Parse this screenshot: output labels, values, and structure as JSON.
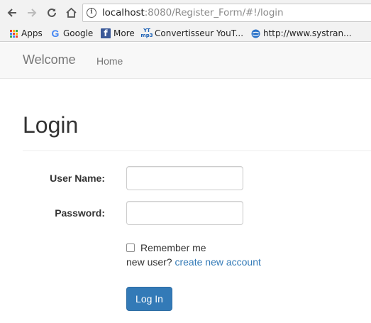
{
  "browser": {
    "url_host": "localhost",
    "url_rest": ":8080/Register_Form/#!/login",
    "bookmarks": [
      {
        "label": "Apps",
        "icon": "apps-grid-icon"
      },
      {
        "label": "Google",
        "icon": "google-icon"
      },
      {
        "label": "More",
        "icon": "facebook-icon"
      },
      {
        "label": "Convertisseur YouT...",
        "icon": "youtube-mp3-icon"
      },
      {
        "label": "http://www.systran...",
        "icon": "systran-globe-icon"
      }
    ]
  },
  "navbar": {
    "brand": "Welcome",
    "home_link": "Home"
  },
  "form": {
    "title": "Login",
    "username_label": "User Name:",
    "username_value": "",
    "password_label": "Password:",
    "password_value": "",
    "remember_label": "Remember me",
    "remember_checked": false,
    "new_user_text": "new user?",
    "create_account_link": "create new account",
    "submit_label": "Log In"
  },
  "colors": {
    "primary": "#337ab7",
    "navbar_bg": "#f8f8f8",
    "link": "#337ab7"
  }
}
